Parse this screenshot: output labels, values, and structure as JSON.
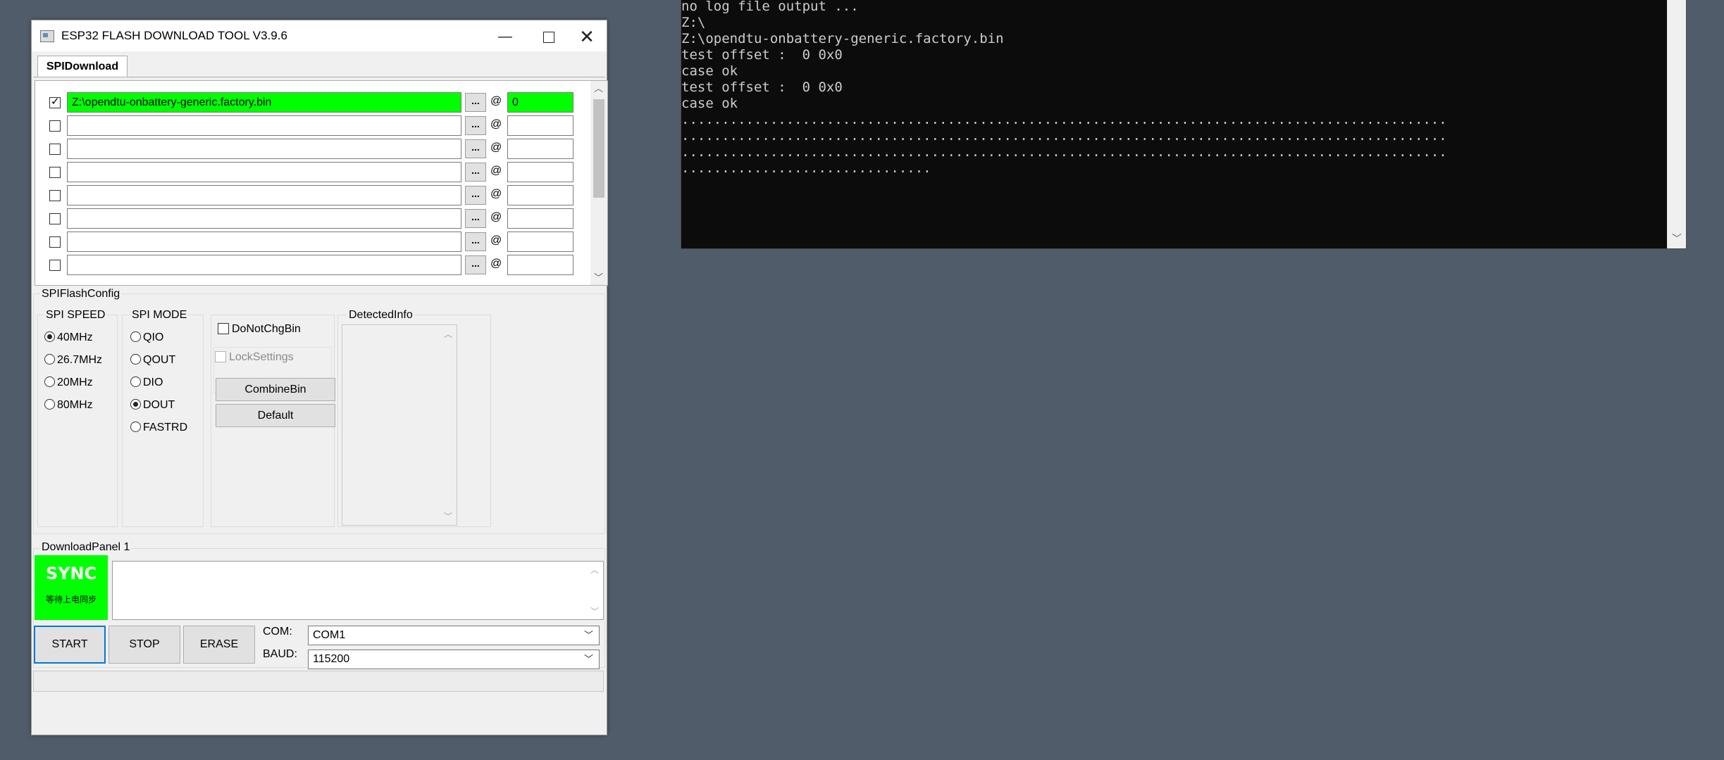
{
  "console": {
    "lines": [
      "no log file output ...",
      "Z:\\",
      "Z:\\opendtu-onbattery-generic.factory.bin",
      "test offset :  0 0x0",
      "case ok",
      "test offset :  0 0x0",
      "case ok",
      "...............................................................................................",
      "...............................................................................................",
      "...............................................................................................",
      "..............................."
    ]
  },
  "window": {
    "title": "ESP32 FLASH DOWNLOAD TOOL V3.9.6",
    "minimize": "—",
    "close": "✕"
  },
  "tab": {
    "label": "SPIDownload"
  },
  "files": [
    {
      "checked": true,
      "path": "Z:\\opendtu-onbattery-generic.factory.bin",
      "address": "0"
    },
    {
      "checked": false,
      "path": "",
      "address": ""
    },
    {
      "checked": false,
      "path": "",
      "address": ""
    },
    {
      "checked": false,
      "path": "",
      "address": ""
    },
    {
      "checked": false,
      "path": "",
      "address": ""
    },
    {
      "checked": false,
      "path": "",
      "address": ""
    },
    {
      "checked": false,
      "path": "",
      "address": ""
    },
    {
      "checked": false,
      "path": "",
      "address": ""
    }
  ],
  "file_browse_label": "...",
  "file_at_label": "@",
  "spiflash": {
    "title": "SPIFlashConfig",
    "speed": {
      "title": "SPI SPEED",
      "options": [
        "40MHz",
        "26.7MHz",
        "20MHz",
        "80MHz"
      ],
      "selected": "40MHz"
    },
    "mode": {
      "title": "SPI MODE",
      "options": [
        "QIO",
        "QOUT",
        "DIO",
        "DOUT",
        "FASTRD"
      ],
      "selected": "DOUT"
    },
    "do_not_chg_bin": "DoNotChgBin",
    "lock_settings": "LockSettings",
    "combine_bin": "CombineBin",
    "default": "Default",
    "detected_title": "DetectedInfo"
  },
  "download": {
    "title": "DownloadPanel 1",
    "sync_title": "SYNC",
    "sync_sub": "等待上电同步",
    "start": "START",
    "stop": "STOP",
    "erase": "ERASE",
    "com_label": "COM:",
    "com_value": "COM1",
    "baud_label": "BAUD:",
    "baud_value": "115200"
  },
  "colors": {
    "active_green": "#00ff00",
    "console_bg": "#0c0c0c",
    "desktop_bg": "#515c6b"
  }
}
